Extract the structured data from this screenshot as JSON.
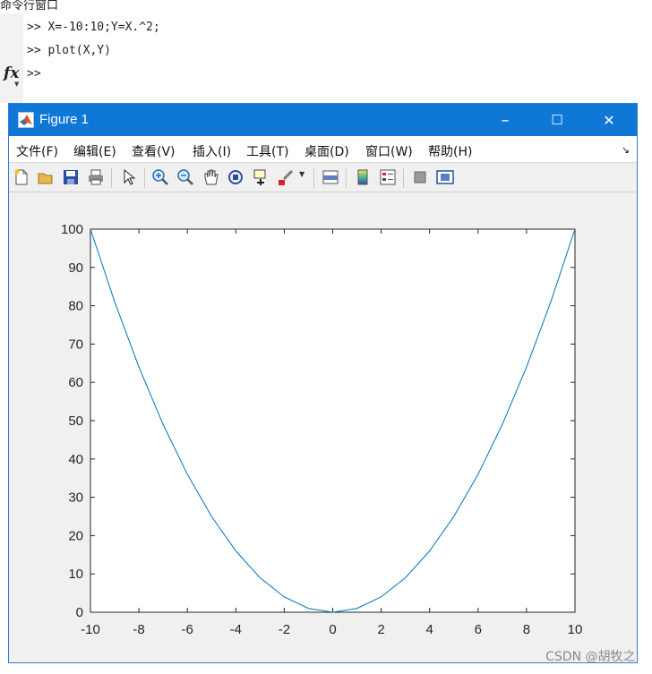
{
  "command_window": {
    "title": "命令行窗口",
    "lines": [
      ">> X=-10:10;Y=X.^2;",
      ">> plot(X,Y)"
    ],
    "prompt": ">>",
    "fx_label": "fx"
  },
  "figure": {
    "title": "Figure 1",
    "controls": {
      "minimize": "–",
      "maximize": "☐",
      "close": "✕"
    },
    "menu": [
      "文件(F)",
      "编辑(E)",
      "查看(V)",
      "插入(I)",
      "工具(T)",
      "桌面(D)",
      "窗口(W)",
      "帮助(H)"
    ],
    "menu_overflow": "↘",
    "toolbar": [
      "new-figure-icon",
      "open-file-icon",
      "save-icon",
      "print-icon",
      "pointer-icon",
      "zoom-in-icon",
      "zoom-out-icon",
      "pan-icon",
      "rotate-3d-icon",
      "data-cursor-icon",
      "brush-icon",
      "link-plot-icon",
      "colorbar-icon",
      "legend-icon",
      "hide-plot-tools-icon",
      "show-plot-tools-icon"
    ]
  },
  "chart_data": {
    "type": "line",
    "x": [
      -10,
      -9,
      -8,
      -7,
      -6,
      -5,
      -4,
      -3,
      -2,
      -1,
      0,
      1,
      2,
      3,
      4,
      5,
      6,
      7,
      8,
      9,
      10
    ],
    "series": [
      {
        "values": [
          100,
          81,
          64,
          49,
          36,
          25,
          16,
          9,
          4,
          1,
          0,
          1,
          4,
          9,
          16,
          25,
          36,
          49,
          64,
          81,
          100
        ],
        "color": "#0072bd"
      }
    ],
    "xlim": [
      -10,
      10
    ],
    "ylim": [
      0,
      100
    ],
    "xticks": [
      -10,
      -8,
      -6,
      -4,
      -2,
      0,
      2,
      4,
      6,
      8,
      10
    ],
    "yticks": [
      0,
      10,
      20,
      30,
      40,
      50,
      60,
      70,
      80,
      90,
      100
    ],
    "xtick_labels": [
      "-10",
      "-8",
      "-6",
      "-4",
      "-2",
      "0",
      "2",
      "4",
      "6",
      "8",
      "10"
    ],
    "ytick_labels": [
      "0",
      "10",
      "20",
      "30",
      "40",
      "50",
      "60",
      "70",
      "80",
      "90",
      "100"
    ],
    "grid": false,
    "title": "",
    "xlabel": "",
    "ylabel": ""
  },
  "watermark": "CSDN @胡牧之.",
  "colors": {
    "titlebar": "#0f78d7",
    "line": "#0072bd",
    "figure_bg": "#f0f0f0"
  }
}
